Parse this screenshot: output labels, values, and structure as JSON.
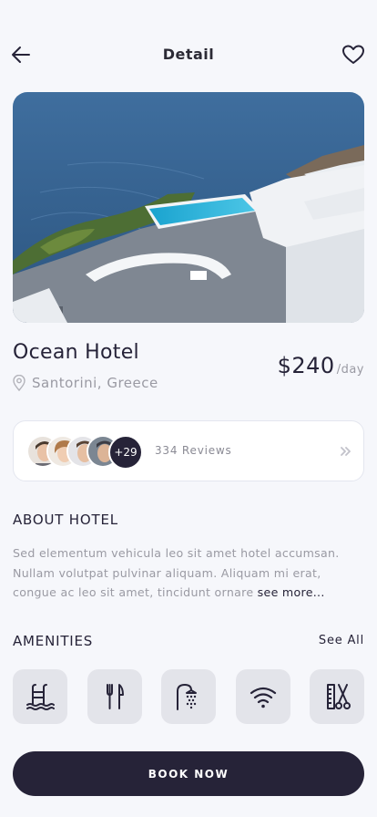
{
  "header": {
    "title": "Detail"
  },
  "hotel": {
    "name": "Ocean Hotel",
    "location": "Santorini, Greece",
    "price": "$240",
    "price_unit": "/day"
  },
  "gallery": {
    "active_index": 0,
    "dot_count": 4
  },
  "reviews": {
    "more_avatars": "+29",
    "count_label": "334 Reviews"
  },
  "about": {
    "title": "ABOUT HOTEL",
    "text": "Sed elementum vehicula leo sit amet hotel accumsan. Nullam volutpat pulvinar aliquam. Aliquam mi erat, congue ac leo sit amet, tincidunt ornare ",
    "see_more": "see more..."
  },
  "amenities": {
    "title": "AMENITIES",
    "see_all": "See All",
    "items": [
      "pool-icon",
      "restaurant-icon",
      "shower-icon",
      "wifi-icon",
      "salon-icon"
    ]
  },
  "cta": {
    "book_label": "BOOK NOW"
  },
  "colors": {
    "primary": "#262338",
    "background": "#f6f7fb",
    "muted": "#9a9aa3",
    "tile": "#e3e4ea"
  }
}
